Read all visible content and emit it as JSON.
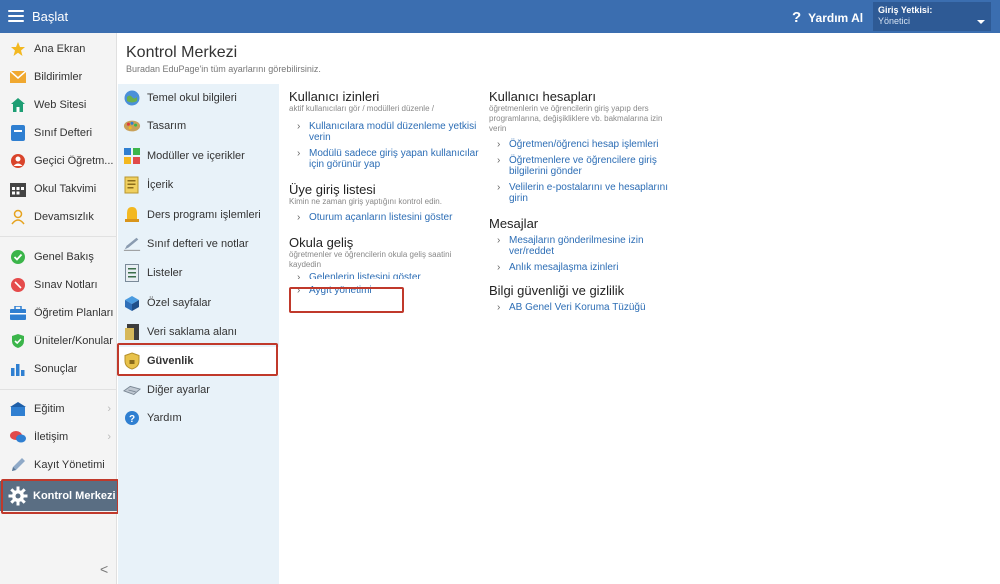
{
  "topbar": {
    "start_label": "Başlat",
    "help_label": "Yardım Al",
    "role_title": "Giriş Yetkisi:",
    "role_value": "Yönetici"
  },
  "sidebar": {
    "items": [
      {
        "label": "Ana Ekran",
        "icon": "star-icon"
      },
      {
        "label": "Bildirimler",
        "icon": "envelope-icon"
      },
      {
        "label": "Web Sitesi",
        "icon": "home-icon"
      },
      {
        "label": "Sınıf Defteri",
        "icon": "notebook-icon"
      },
      {
        "label": "Geçici Öğretm...",
        "icon": "substitute-icon"
      },
      {
        "label": "Okul Takvimi",
        "icon": "calendar-icon"
      },
      {
        "label": "Devamsızlık",
        "icon": "absence-icon"
      },
      {
        "label": "Genel Bakış",
        "icon": "check-circle-icon"
      },
      {
        "label": "Sınav Notları",
        "icon": "grades-icon"
      },
      {
        "label": "Öğretim Planları",
        "icon": "briefcase-icon"
      },
      {
        "label": "Üniteler/Konular",
        "icon": "shield-check-icon"
      },
      {
        "label": "Sonuçlar",
        "icon": "bar-chart-icon"
      },
      {
        "label": "Eğitim",
        "icon": "education-icon"
      },
      {
        "label": "İletişim",
        "icon": "chat-icon"
      },
      {
        "label": "Kayıt Yönetimi",
        "icon": "pen-icon"
      },
      {
        "label": "Kontrol Merkezi",
        "icon": "gear-icon"
      }
    ],
    "collapse_label": "<"
  },
  "header": {
    "title": "Kontrol Merkezi",
    "subtitle": "Buradan EduPage'in tüm ayarlarını görebilirsiniz."
  },
  "midpanel": {
    "items": [
      {
        "label": "Temel okul bilgileri",
        "icon": "school-icon"
      },
      {
        "label": "Tasarım",
        "icon": "palette-icon"
      },
      {
        "label": "Modüller ve içerikler",
        "icon": "modules-icon"
      },
      {
        "label": "İçerik",
        "icon": "content-icon"
      },
      {
        "label": "Ders programı işlemleri",
        "icon": "timetable-icon"
      },
      {
        "label": "Sınıf defteri ve notlar",
        "icon": "pencil-icon"
      },
      {
        "label": "Listeler",
        "icon": "list-icon"
      },
      {
        "label": "Özel sayfalar",
        "icon": "pages-icon"
      },
      {
        "label": "Veri saklama alanı",
        "icon": "storage-icon"
      },
      {
        "label": "Güvenlik",
        "icon": "security-shield-icon"
      },
      {
        "label": "Diğer ayarlar",
        "icon": "other-settings-icon"
      },
      {
        "label": "Yardım",
        "icon": "help-icon"
      }
    ]
  },
  "content": {
    "permissions": {
      "title": "Kullanıcı izinleri",
      "desc": "aktif kullanıcıları gör / modülleri düzenle /",
      "links": [
        "Kullanıcılara modül düzenleme yetkisi verin",
        "Modülü sadece giriş yapan kullanıcılar için görünür yap"
      ]
    },
    "login_list": {
      "title": "Üye giriş listesi",
      "desc": "Kimin ne zaman giriş yaptığını kontrol edin.",
      "links": [
        "Oturum açanların listesini göster"
      ]
    },
    "arrival": {
      "title": "Okula geliş",
      "desc": "öğretmenler ve öğrencilerin okula geliş saatini kaydedin",
      "links": [
        "Gelenlerin listesini göster",
        "Aygıt yönetimi"
      ]
    },
    "accounts": {
      "title": "Kullanıcı hesapları",
      "desc": "öğretmenlerin ve öğrencilerin giriş yapıp ders programlarına, değişikliklere vb. bakmalarına izin verin",
      "links": [
        "Öğretmen/öğrenci hesap işlemleri",
        "Öğretmenlere ve öğrencilere giriş bilgilerini gönder",
        "Velilerin e-postalarını ve hesaplarını girin"
      ]
    },
    "messages": {
      "title": "Mesajlar",
      "links": [
        "Mesajların gönderilmesine izin ver/reddet",
        "Anlık mesajlaşma izinleri"
      ]
    },
    "privacy": {
      "title": "Bilgi güvenliği ve gizlilik",
      "links": [
        "AB Genel Veri Koruma Tüzüğü"
      ]
    },
    "arrow": "›"
  }
}
